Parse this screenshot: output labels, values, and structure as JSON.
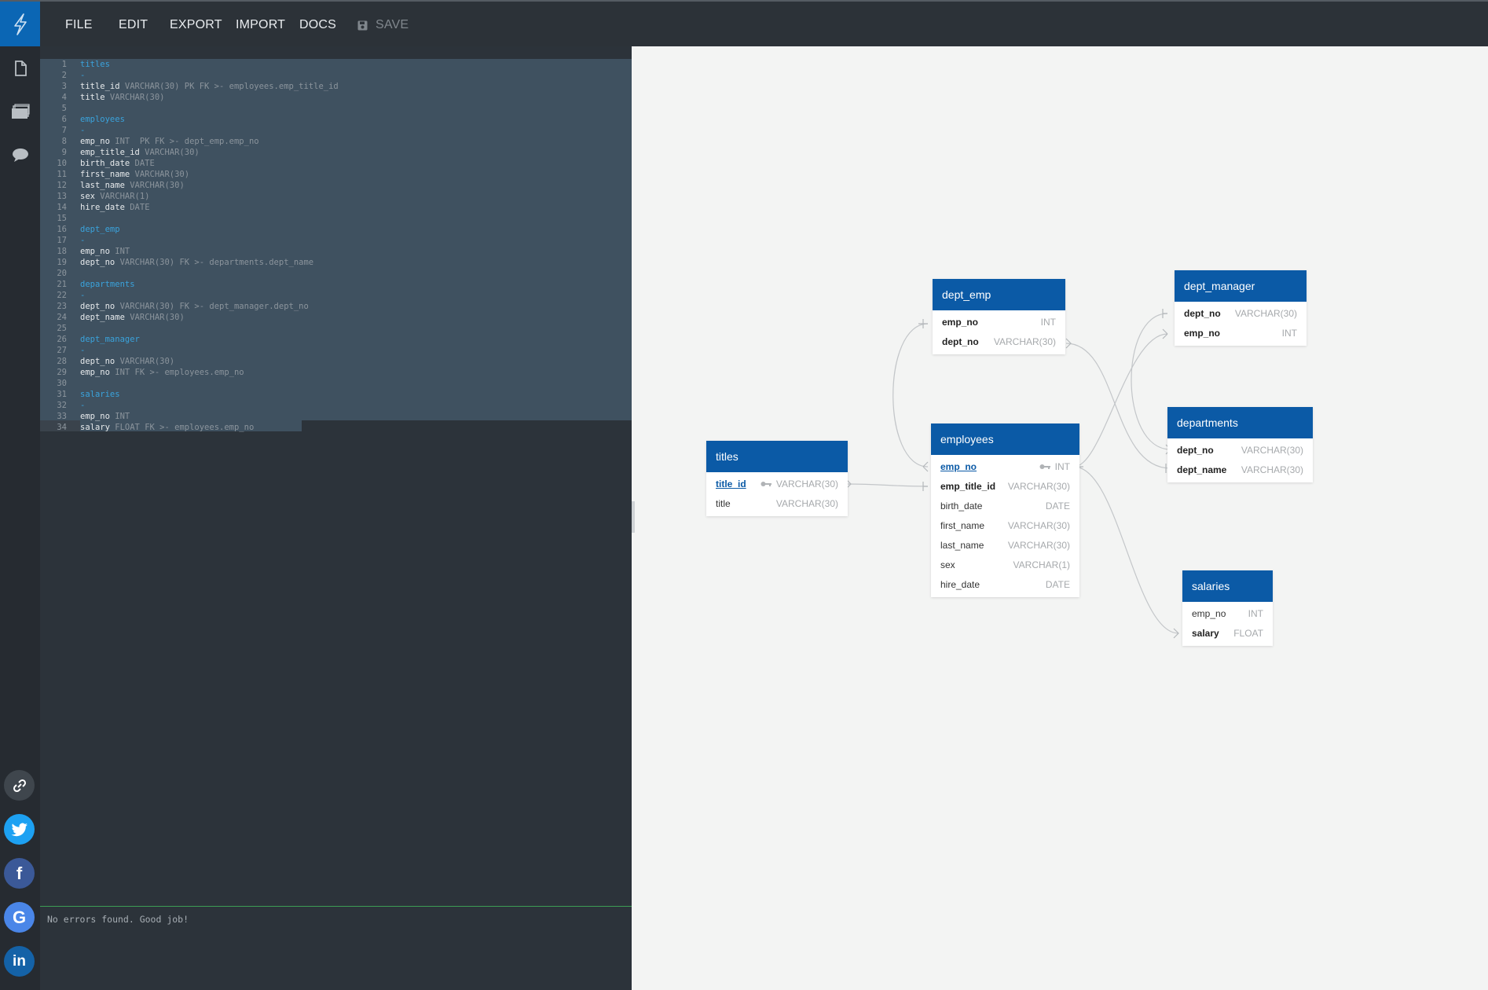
{
  "menu": {
    "file": "FILE",
    "edit": "EDIT",
    "export": "EXPORT",
    "import": "IMPORT",
    "docs": "DOCS",
    "save": "SAVE"
  },
  "icons": {
    "logo": "lightning-icon",
    "document": "document-icon",
    "folder": "folder-icon",
    "chat": "chat-icon",
    "link": "link-icon",
    "twitter": "twitter-icon",
    "facebook": "facebook-icon",
    "google": "google-icon",
    "linkedin": "linkedin-icon",
    "save": "save-icon"
  },
  "social": {
    "facebook": "f",
    "google": "G",
    "linkedin": "in"
  },
  "editor": {
    "lines": [
      {
        "n": "1",
        "text": "titles",
        "kind": "tbl"
      },
      {
        "n": "2",
        "text": "-",
        "kind": "dash"
      },
      {
        "n": "3",
        "col": "title_id",
        "rest": " VARCHAR(30) PK FK >- employees.emp_title_id"
      },
      {
        "n": "4",
        "col": "title",
        "rest": " VARCHAR(30)"
      },
      {
        "n": "5",
        "text": ""
      },
      {
        "n": "6",
        "text": "employees",
        "kind": "tbl"
      },
      {
        "n": "7",
        "text": "-",
        "kind": "dash"
      },
      {
        "n": "8",
        "col": "emp_no",
        "rest": " INT  PK FK >- dept_emp.emp_no"
      },
      {
        "n": "9",
        "col": "emp_title_id",
        "rest": " VARCHAR(30)"
      },
      {
        "n": "10",
        "col": "birth_date",
        "rest": " DATE"
      },
      {
        "n": "11",
        "col": "first_name",
        "rest": " VARCHAR(30)"
      },
      {
        "n": "12",
        "col": "last_name",
        "rest": " VARCHAR(30)"
      },
      {
        "n": "13",
        "col": "sex",
        "rest": " VARCHAR(1)"
      },
      {
        "n": "14",
        "col": "hire_date",
        "rest": " DATE"
      },
      {
        "n": "15",
        "text": ""
      },
      {
        "n": "16",
        "text": "dept_emp",
        "kind": "tbl"
      },
      {
        "n": "17",
        "text": "-",
        "kind": "dash"
      },
      {
        "n": "18",
        "col": "emp_no",
        "rest": " INT"
      },
      {
        "n": "19",
        "col": "dept_no",
        "rest": " VARCHAR(30) FK >- departments.dept_name"
      },
      {
        "n": "20",
        "text": ""
      },
      {
        "n": "21",
        "text": "departments",
        "kind": "tbl"
      },
      {
        "n": "22",
        "text": "-",
        "kind": "dash"
      },
      {
        "n": "23",
        "col": "dept_no",
        "rest": " VARCHAR(30) FK >- dept_manager.dept_no"
      },
      {
        "n": "24",
        "col": "dept_name",
        "rest": " VARCHAR(30)"
      },
      {
        "n": "25",
        "text": ""
      },
      {
        "n": "26",
        "text": "dept_manager",
        "kind": "tbl"
      },
      {
        "n": "27",
        "text": "-",
        "kind": "dash"
      },
      {
        "n": "28",
        "col": "dept_no",
        "rest": " VARCHAR(30)"
      },
      {
        "n": "29",
        "col": "emp_no",
        "rest": " INT FK >- employees.emp_no"
      },
      {
        "n": "30",
        "text": ""
      },
      {
        "n": "31",
        "text": "salaries",
        "kind": "tbl"
      },
      {
        "n": "32",
        "text": "-",
        "kind": "dash"
      },
      {
        "n": "33",
        "col": "emp_no",
        "rest": " INT"
      },
      {
        "n": "34",
        "col": "salary",
        "rest": " FLOAT FK >- employees.emp_no"
      }
    ]
  },
  "console": {
    "message": "No errors found. Good job!"
  },
  "diagram": {
    "tables": [
      {
        "id": "dept_emp",
        "name": "dept_emp",
        "rows": [
          {
            "name": "emp_no",
            "type": "INT",
            "style": "fk"
          },
          {
            "name": "dept_no",
            "type": "VARCHAR(30)",
            "style": "fk"
          }
        ]
      },
      {
        "id": "dept_manager",
        "name": "dept_manager",
        "rows": [
          {
            "name": "dept_no",
            "type": "VARCHAR(30)",
            "style": "fk"
          },
          {
            "name": "emp_no",
            "type": "INT",
            "style": "fk"
          }
        ]
      },
      {
        "id": "departments",
        "name": "departments",
        "rows": [
          {
            "name": "dept_no",
            "type": "VARCHAR(30)",
            "style": "fk"
          },
          {
            "name": "dept_name",
            "type": "VARCHAR(30)",
            "style": "fk"
          }
        ]
      },
      {
        "id": "titles",
        "name": "titles",
        "rows": [
          {
            "name": "title_id",
            "type": "VARCHAR(30)",
            "style": "pk",
            "key": true
          },
          {
            "name": "title",
            "type": "VARCHAR(30)",
            "style": "plain"
          }
        ]
      },
      {
        "id": "employees",
        "name": "employees",
        "rows": [
          {
            "name": "emp_no",
            "type": "INT",
            "style": "pk",
            "key": true
          },
          {
            "name": "emp_title_id",
            "type": "VARCHAR(30)",
            "style": "fk"
          },
          {
            "name": "birth_date",
            "type": "DATE",
            "style": "plain"
          },
          {
            "name": "first_name",
            "type": "VARCHAR(30)",
            "style": "plain"
          },
          {
            "name": "last_name",
            "type": "VARCHAR(30)",
            "style": "plain"
          },
          {
            "name": "sex",
            "type": "VARCHAR(1)",
            "style": "plain"
          },
          {
            "name": "hire_date",
            "type": "DATE",
            "style": "plain"
          }
        ]
      },
      {
        "id": "salaries",
        "name": "salaries",
        "rows": [
          {
            "name": "emp_no",
            "type": "INT",
            "style": "plain"
          },
          {
            "name": "salary",
            "type": "FLOAT",
            "style": "fk"
          }
        ]
      }
    ]
  }
}
